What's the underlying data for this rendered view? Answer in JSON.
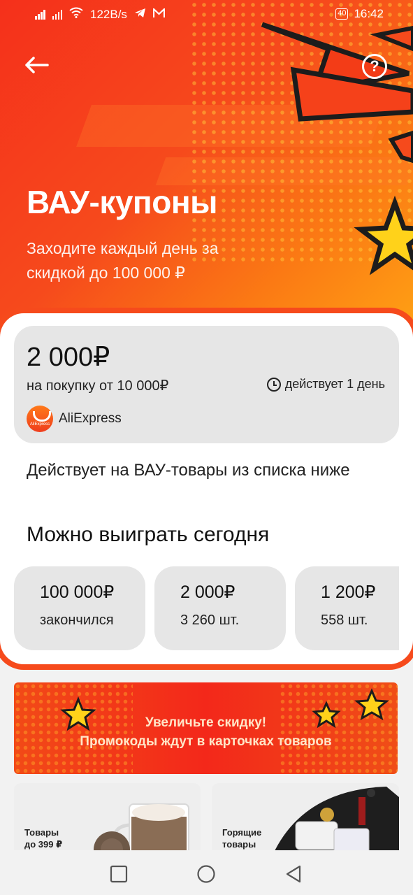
{
  "status_bar": {
    "speed": "122B/s",
    "battery": "40",
    "time": "16:42"
  },
  "header": {
    "back_icon": "arrow-left-icon",
    "help_icon": "question-circle-icon",
    "help_glyph": "?",
    "title": "ВАУ-купоны",
    "subtitle": "Заходите каждый день за скидкой до 100 000 ₽"
  },
  "coupon": {
    "amount": "2 000₽",
    "condition": "на покупку от 10 000₽",
    "validity": "действует 1 день",
    "brand": "AliExpress",
    "brand_logo_text": "AliExpress"
  },
  "note": "Действует на ВАУ-товары из списка ниже",
  "prizes": {
    "title": "Можно выиграть сегодня",
    "items": [
      {
        "value": "100 000₽",
        "status": "закончился"
      },
      {
        "value": "2 000₽",
        "status": "3 260 шт."
      },
      {
        "value": "1 200₽",
        "status": "558 шт."
      }
    ]
  },
  "banner": {
    "line1": "Увеличьте скидку!",
    "line2": "Промокоды ждут в карточках товаров"
  },
  "tiles": [
    {
      "line1": "Товары",
      "line2": "до 399 ₽"
    },
    {
      "line1": "Горящие",
      "line2": "товары"
    }
  ],
  "colors": {
    "accent": "#f64a1c",
    "card_bg": "#e6e6e6",
    "star": "#ffd21a"
  }
}
